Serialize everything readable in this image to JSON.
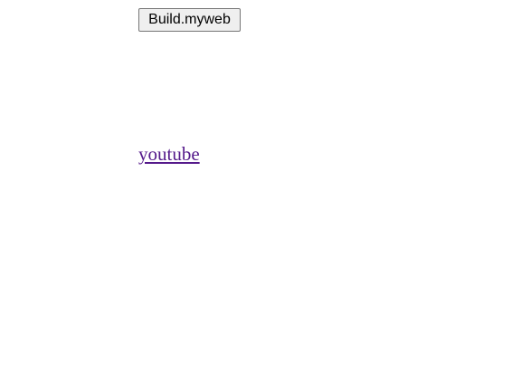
{
  "toolbar": {
    "build_button_label": "Build.myweb"
  },
  "links": {
    "youtube_label": "youtube"
  },
  "colors": {
    "background": "#ffffff",
    "visited_link": "#551a8b",
    "button_face": "#efefef",
    "button_border": "#767676"
  }
}
